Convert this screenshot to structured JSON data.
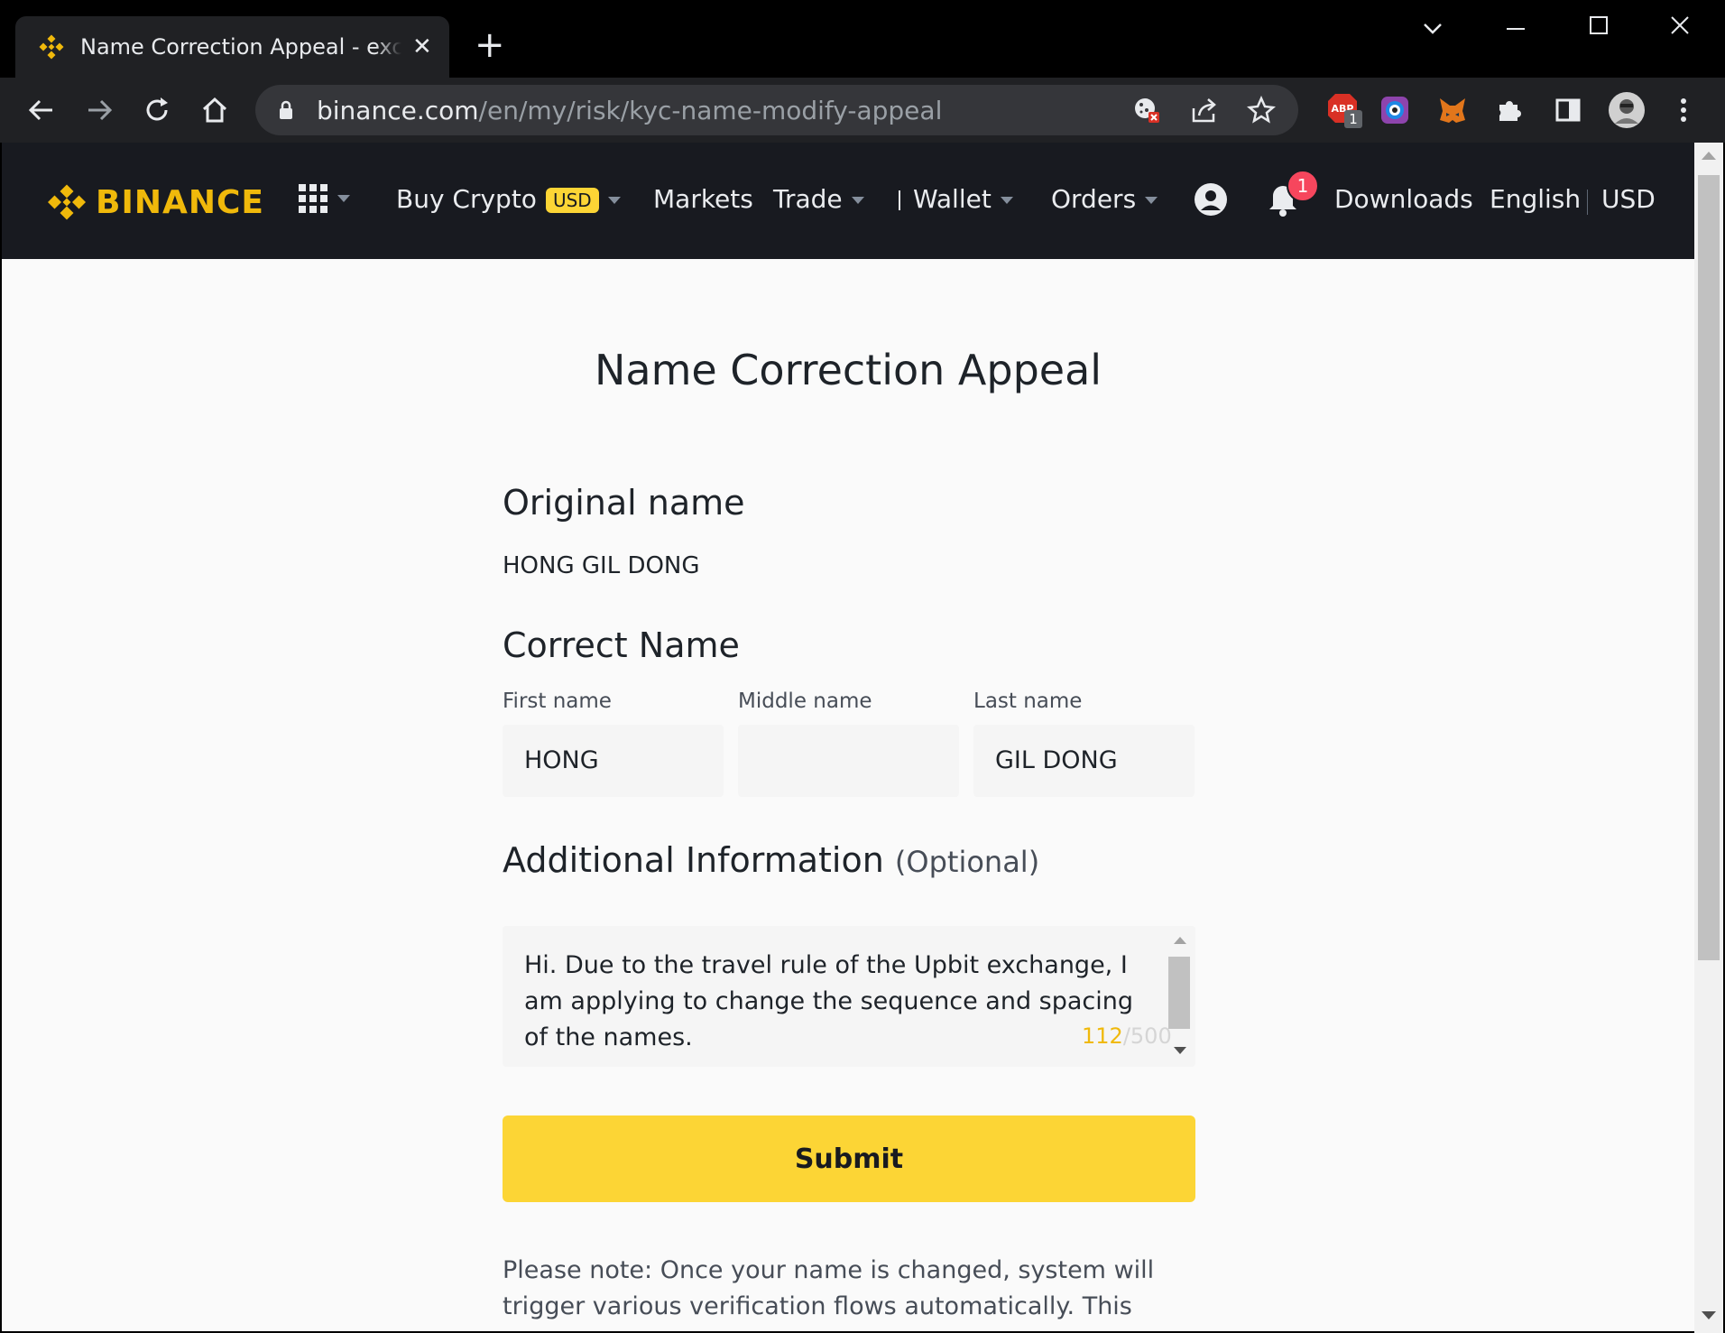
{
  "browser": {
    "tab_title": "Name Correction Appeal - exchange",
    "new_tab": "+",
    "url_host": "binance.com",
    "url_path": "/en/my/risk/kyc-name-modify-appeal",
    "abp_badge": "1"
  },
  "nav": {
    "logo_text": "BINANCE",
    "buy_crypto": "Buy Crypto",
    "buy_crypto_badge": "USD",
    "markets": "Markets",
    "trade": "Trade",
    "wallet": "Wallet",
    "orders": "Orders",
    "notification_count": "1",
    "downloads": "Downloads",
    "language": "English",
    "currency": "USD"
  },
  "form": {
    "title": "Name Correction Appeal",
    "original_heading": "Original name",
    "original_value": "HONG GIL DONG",
    "correct_heading": "Correct Name",
    "first_label": "First name",
    "first_value": "HONG",
    "middle_label": "Middle name",
    "middle_value": "",
    "last_label": "Last name",
    "last_value": "GIL DONG",
    "additional_heading": "Additional Information",
    "optional": "(Optional)",
    "additional_text": "Hi. Due to the travel rule of the Upbit exchange, I am applying to change the sequence and spacing of the names.",
    "char_count": "112",
    "char_max": "/500",
    "submit": "Submit",
    "note": "Please note: Once your name is changed, system will trigger various verification flows automatically. This may affect your ..."
  },
  "colors": {
    "accent": "#fcd535",
    "brand": "#f0b90b",
    "nav_bg": "#181a20",
    "badge_red": "#f6465d"
  }
}
